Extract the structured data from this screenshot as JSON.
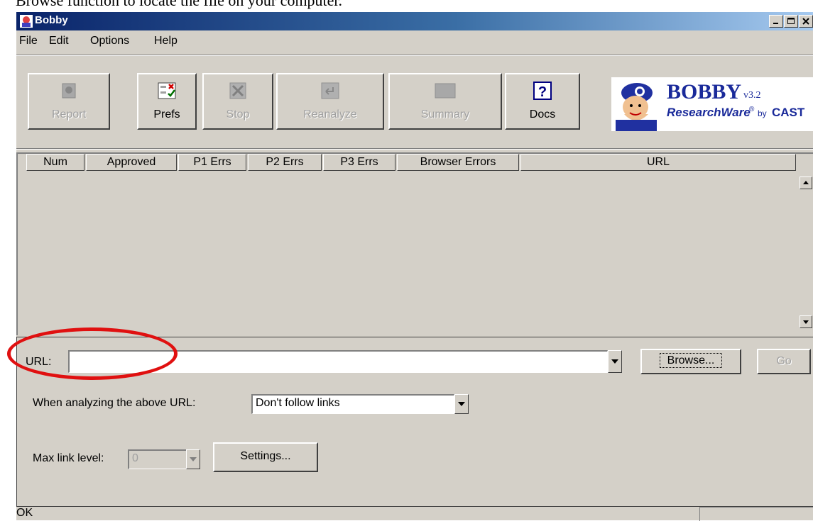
{
  "caption": "Browse function to locate the file on your computer.",
  "window": {
    "title": "Bobby",
    "controls": [
      "_",
      "□",
      "×"
    ]
  },
  "menu": [
    {
      "label": "File"
    },
    {
      "label": "Edit"
    },
    {
      "label": "Options"
    },
    {
      "label": "Help"
    }
  ],
  "toolbar": {
    "report": "Report",
    "prefs": "Prefs",
    "stop": "Stop",
    "reanalyze": "Reanalyze",
    "summary": "Summary",
    "docs": "Docs"
  },
  "logo": {
    "name": "BOBBY",
    "version": "v3.2",
    "tagline": "ResearchWare",
    "reg": "®",
    "by": "by",
    "org": "CAST"
  },
  "table": {
    "columns": [
      "Num",
      "Approved",
      "P1 Errs",
      "P2 Errs",
      "P3 Errs",
      "Browser Errors",
      "URL"
    ]
  },
  "form": {
    "url_label": "URL:",
    "url_value": "",
    "browse": "Browse...",
    "go": "Go",
    "analyzing_label": "When analyzing the above URL:",
    "follow_value": "Don't follow links",
    "max_link_label": "Max link level:",
    "max_link_value": "0",
    "settings": "Settings..."
  },
  "status": {
    "text": "OK"
  },
  "colors": {
    "highlight_ellipse": "#e01010",
    "window_bg": "#d4d0c8",
    "titlebar_start": "#0a246a"
  }
}
